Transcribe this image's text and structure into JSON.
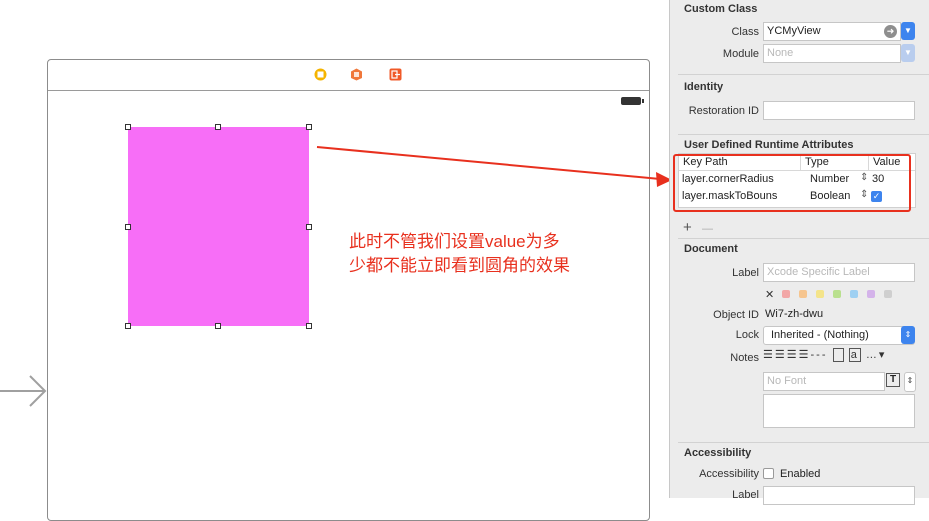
{
  "annotation": {
    "line1": "此时不管我们设置value为多",
    "line2": "少都不能立即看到圆角的效果"
  },
  "inspector": {
    "custom_class": {
      "title": "Custom Class",
      "class_label": "Class",
      "class_value": "YCMyView",
      "module_label": "Module",
      "module_placeholder": "None"
    },
    "identity": {
      "title": "Identity",
      "restoration_label": "Restoration ID",
      "restoration_value": ""
    },
    "runtime": {
      "title": "User Defined Runtime Attributes",
      "headers": [
        "Key Path",
        "Type",
        "Value"
      ],
      "rows": [
        {
          "key": "layer.cornerRadius",
          "type": "Number",
          "value": "30"
        },
        {
          "key": "layer.maskToBouns",
          "type": "Boolean",
          "value": "✓"
        }
      ],
      "add": "+",
      "remove": "—"
    },
    "document": {
      "title": "Document",
      "label_label": "Label",
      "label_placeholder": "Xcode Specific Label",
      "clear_symbol": "✕",
      "swatch_colors": [
        "#f2a7a7",
        "#f6c58f",
        "#f4e48a",
        "#b9e08e",
        "#9fd0f2",
        "#d4b3ea",
        "#cfcfcf"
      ],
      "object_id_label": "Object ID",
      "object_id_value": "Wi7-zh-dwu",
      "lock_label": "Lock",
      "lock_value": "Inherited - (Nothing)",
      "notes_label": "Notes",
      "font_placeholder": "No Font"
    },
    "accessibility": {
      "title": "Accessibility",
      "accessibility_label": "Accessibility",
      "enabled_label": "Enabled",
      "label_label": "Label"
    }
  }
}
